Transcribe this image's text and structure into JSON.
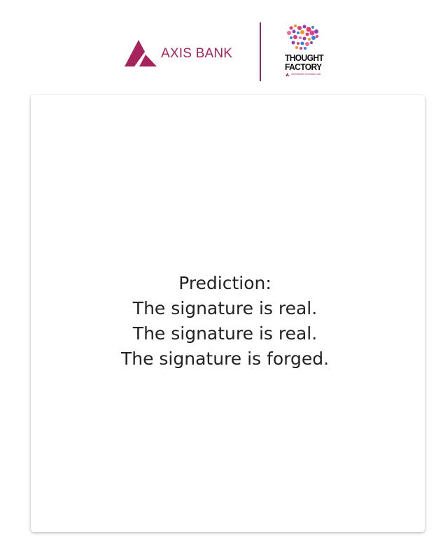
{
  "header": {
    "axis_logo_text": "AXIS BANK",
    "thought_factory_line1": "THOUGHT",
    "thought_factory_line2": "FACTORY",
    "thought_factory_sub": "AXIS BANK Innovation Lab"
  },
  "colors": {
    "brand": "#a6245b",
    "text": "#222222"
  },
  "result": {
    "heading": "Prediction:",
    "lines": [
      "The signature is real.",
      "The signature is real.",
      "The signature is forged."
    ]
  }
}
